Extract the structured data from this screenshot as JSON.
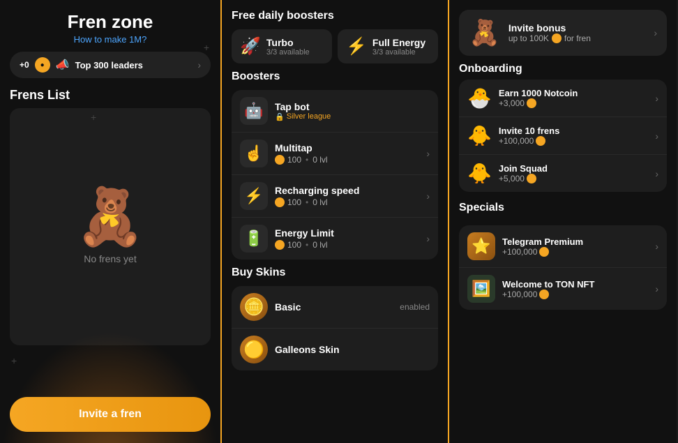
{
  "left": {
    "title": "Fren zone",
    "subtitle": "How to make 1M?",
    "plus_zero": "+0",
    "top_leaders": "Top 300 leaders",
    "frens_list_title": "Frens List",
    "no_frens": "No frens yet",
    "invite_btn": "Invite a fren",
    "bear_emoji": "🧸"
  },
  "mid": {
    "daily_boosters_title": "Free daily boosters",
    "boosters_title": "Boosters",
    "buy_skins_title": "Buy Skins",
    "daily": [
      {
        "name": "Turbo",
        "avail": "3/3 available",
        "icon": "🚀"
      },
      {
        "name": "Full Energy",
        "avail": "3/3 available",
        "icon": "⚡"
      }
    ],
    "boosters": [
      {
        "name": "Tap bot",
        "sub": "Silver league",
        "icon": "🤖",
        "locked": true
      },
      {
        "name": "Multitap",
        "cost": "100",
        "level": "0 lvl",
        "icon": "☝️"
      },
      {
        "name": "Recharging speed",
        "cost": "100",
        "level": "0 lvl",
        "icon": "⚡"
      },
      {
        "name": "Energy Limit",
        "cost": "100",
        "level": "0 lvl",
        "icon": "🔋"
      }
    ],
    "skins": [
      {
        "name": "Basic",
        "status": "enabled",
        "icon": "🪙"
      },
      {
        "name": "Galleons Skin",
        "status": "",
        "icon": "🟡"
      }
    ]
  },
  "right": {
    "invite_bonus_title": "Invite bonus",
    "invite_bonus_sub": "up to 100K",
    "invite_bonus_sub2": "for fren",
    "onboarding_title": "Onboarding",
    "onboarding_items": [
      {
        "name": "Earn 1000 Notcoin",
        "reward": "+3,000",
        "icon": "🐣"
      },
      {
        "name": "Invite 10 frens",
        "reward": "+100,000",
        "icon": "🐥"
      },
      {
        "name": "Join Squad",
        "reward": "+5,000",
        "icon": "🐥"
      }
    ],
    "specials_title": "Specials",
    "specials": [
      {
        "name": "Telegram Premium",
        "reward": "+100,000",
        "icon": "⭐",
        "type": "star"
      },
      {
        "name": "Welcome to TON NFT",
        "reward": "+100,000",
        "icon": "🖼️",
        "type": "nft"
      }
    ]
  }
}
